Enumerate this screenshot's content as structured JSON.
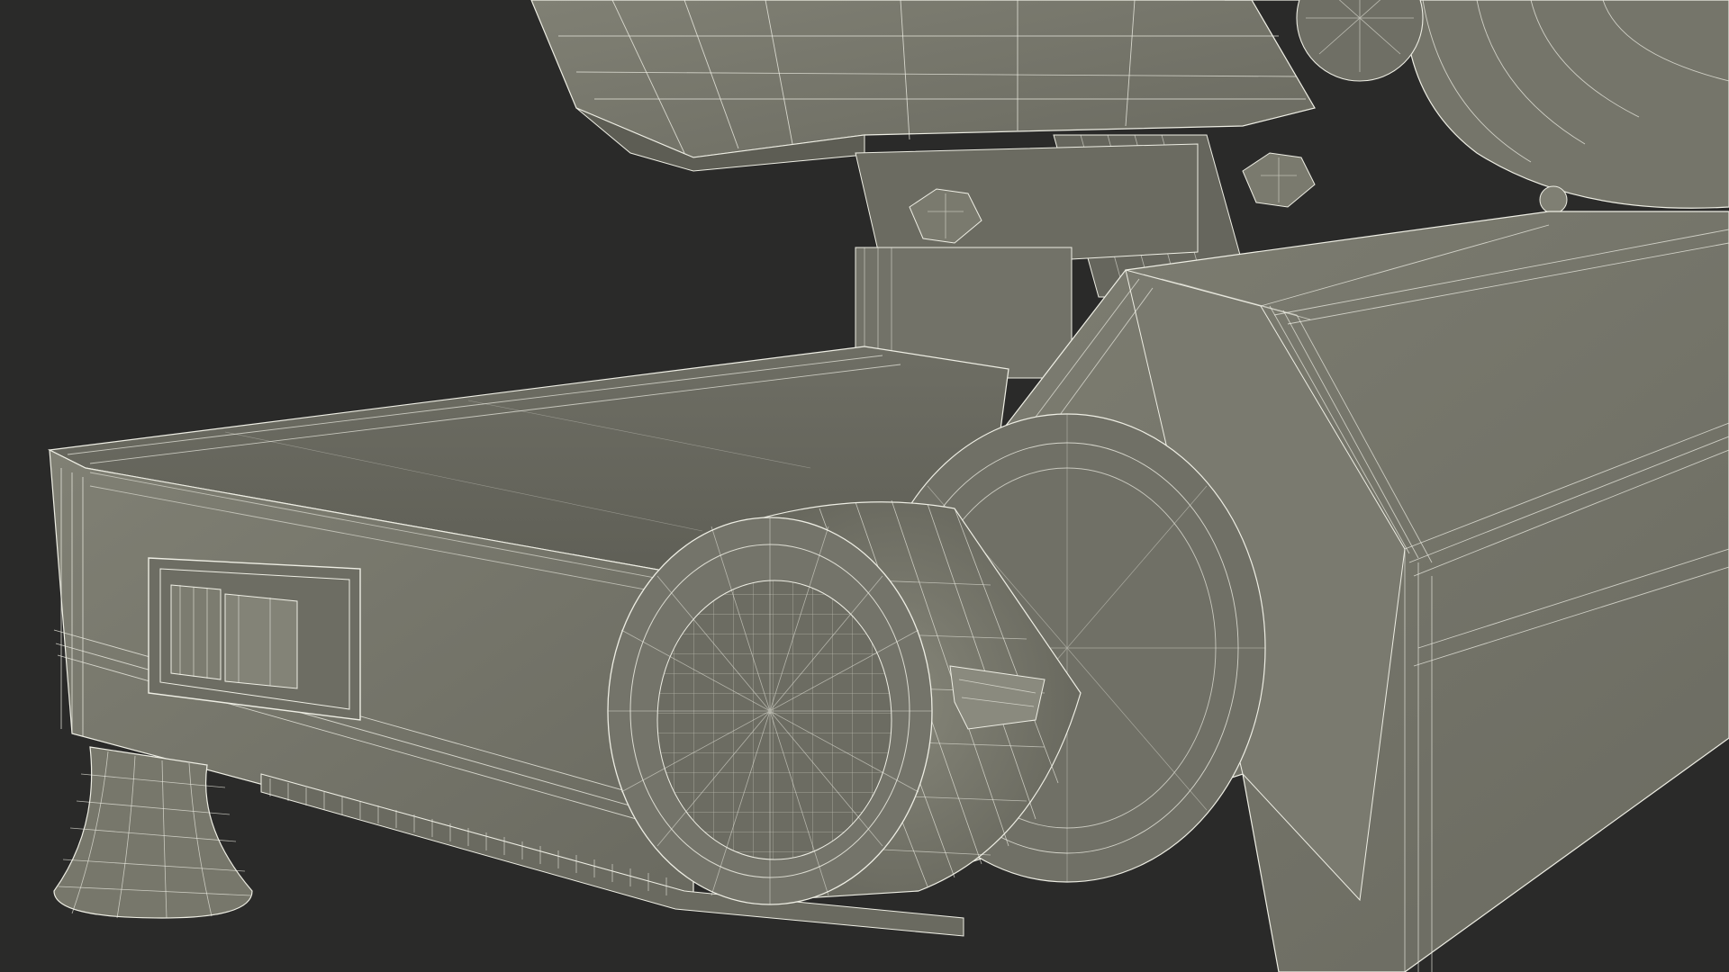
{
  "scene": {
    "subject": "wireframe-render-of-meat-slicer",
    "background_color": "#2a2a29",
    "surface_color": "#77776b",
    "surface_shadow_color": "#5c5c53",
    "surface_highlight_color": "#8a8a7e",
    "wire_color": "#eeeee4"
  }
}
